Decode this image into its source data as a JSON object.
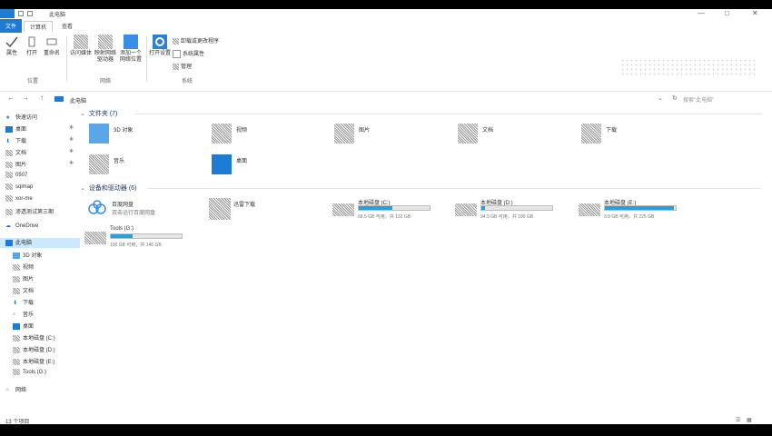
{
  "window": {
    "title": "此电脑",
    "minimize": "—",
    "maximize": "□",
    "close": "✕"
  },
  "tabs": [
    {
      "label": "文件"
    },
    {
      "label": "计算机"
    },
    {
      "label": "查看"
    }
  ],
  "ribbon": {
    "location_buttons": [
      {
        "label": "属性"
      },
      {
        "label": "打开"
      },
      {
        "label": "重命名"
      }
    ],
    "network_buttons": [
      {
        "label": "访问媒体"
      },
      {
        "label": "映射网络驱动器"
      },
      {
        "label": "添加一个网络位置"
      }
    ],
    "system_button": {
      "label": "打开设置"
    },
    "system_links": [
      {
        "label": "卸载或更改程序"
      },
      {
        "label": "系统属性"
      },
      {
        "label": "管理"
      }
    ],
    "groups": {
      "location": "位置",
      "network": "网络",
      "system": "系统"
    }
  },
  "address": {
    "back": "←",
    "forward": "→",
    "up": "↑",
    "path": "此电脑",
    "search_placeholder": "搜索\"此电脑\""
  },
  "sidebar": {
    "quick_access": "快速访问",
    "pinned": [
      {
        "label": "桌面"
      },
      {
        "label": "下载"
      },
      {
        "label": "文档"
      },
      {
        "label": "图片"
      }
    ],
    "recent": [
      {
        "label": "0507"
      },
      {
        "label": "sqlmap"
      },
      {
        "label": "xor-me"
      },
      {
        "label": "渗透测试第三期"
      }
    ],
    "onedrive": "OneDrive",
    "this_pc": "此电脑",
    "pc_items": [
      {
        "label": "3D 对象"
      },
      {
        "label": "视频"
      },
      {
        "label": "图片"
      },
      {
        "label": "文档"
      },
      {
        "label": "下载"
      },
      {
        "label": "音乐"
      },
      {
        "label": "桌面"
      },
      {
        "label": "本地磁盘 (C:)"
      },
      {
        "label": "本地磁盘 (D:)"
      },
      {
        "label": "本地磁盘 (E:)"
      },
      {
        "label": "Tools (G:)"
      }
    ],
    "network": "网络"
  },
  "folders_section": {
    "title": "文件夹 (7)"
  },
  "folders": [
    {
      "label": "3D 对象"
    },
    {
      "label": "视频"
    },
    {
      "label": "图片"
    },
    {
      "label": "文档"
    },
    {
      "label": "下载"
    },
    {
      "label": "音乐"
    },
    {
      "label": "桌面"
    }
  ],
  "devices_section": {
    "title": "设备和驱动器 (6)"
  },
  "devices": [
    {
      "label": "百度网盘",
      "sub": "双击运行百度网盘"
    },
    {
      "label": "迅雷下载",
      "sub": ""
    }
  ],
  "drives": [
    {
      "label": "本地磁盘 (C:)",
      "sub": "68.5 GB 可用，共 132 GB",
      "used": 0.48
    },
    {
      "label": "本地磁盘 (D:)",
      "sub": "94.9 GB 可用，共 100 GB",
      "used": 0.05
    },
    {
      "label": "本地磁盘 (E:)",
      "sub": "3.9 GB 可用，共 225 GB",
      "used": 0.98
    },
    {
      "label": "Tools (G:)",
      "sub": "100 GB 可用，共 146 GB",
      "used": 0.31
    }
  ],
  "status": {
    "count": "13 个项目"
  },
  "colors": {
    "accent": "#1e7bd3",
    "drive_fill": "#26a0da",
    "section": "#1e3b6b"
  }
}
